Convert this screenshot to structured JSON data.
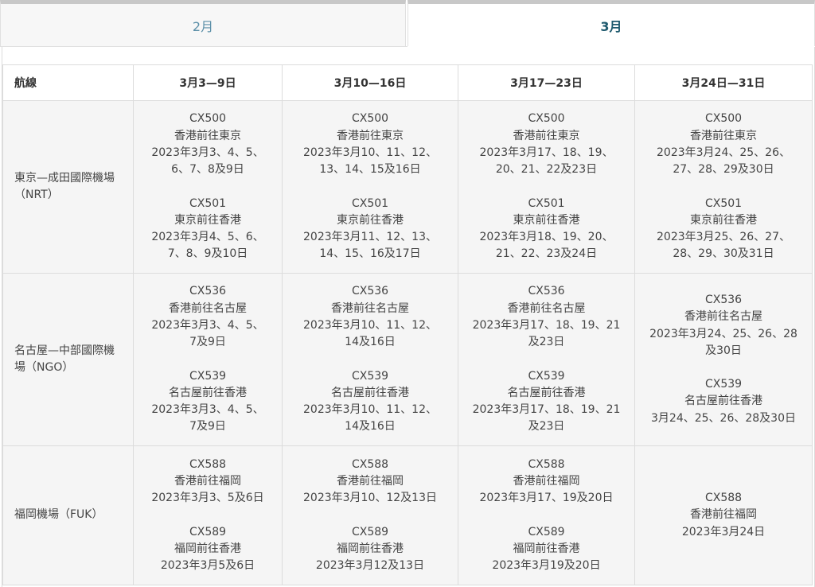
{
  "tabs": [
    {
      "label": "2月",
      "active": false
    },
    {
      "label": "3月",
      "active": true
    }
  ],
  "table": {
    "headers": [
      "航線",
      "3月3—9日",
      "3月10—16日",
      "3月17—23日",
      "3月24日—31日"
    ],
    "rows": [
      {
        "route": "東京—成田國際機場（NRT）",
        "cells": [
          [
            {
              "code": "CX500",
              "dir": "香港前往東京",
              "dates": [
                "2023年3月3、4、5、",
                "6、7、8及9日"
              ]
            },
            {
              "code": "CX501",
              "dir": "東京前往香港",
              "dates": [
                "2023年3月4、5、6、",
                "7、8、9及10日"
              ]
            }
          ],
          [
            {
              "code": "CX500",
              "dir": "香港前往東京",
              "dates": [
                "2023年3月10、11、12、",
                "13、14、15及16日"
              ]
            },
            {
              "code": "CX501",
              "dir": "東京前往香港",
              "dates": [
                "2023年3月11、12、13、",
                "14、15、16及17日"
              ]
            }
          ],
          [
            {
              "code": "CX500",
              "dir": "香港前往東京",
              "dates": [
                "2023年3月17、18、19、",
                "20、21、22及23日"
              ]
            },
            {
              "code": "CX501",
              "dir": "東京前往香港",
              "dates": [
                "2023年3月18、19、20、",
                "21、22、23及24日"
              ]
            }
          ],
          [
            {
              "code": "CX500",
              "dir": "香港前往東京",
              "dates": [
                "2023年3月24、25、26、",
                "27、28、29及30日"
              ]
            },
            {
              "code": "CX501",
              "dir": "東京前往香港",
              "dates": [
                "2023年3月25、26、27、",
                "28、29、30及31日"
              ]
            }
          ]
        ]
      },
      {
        "route": "名古屋—中部國際機場（NGO）",
        "cells": [
          [
            {
              "code": "CX536",
              "dir": "香港前往名古屋",
              "dates": [
                "2023年3月3、4、5、",
                "7及9日"
              ]
            },
            {
              "code": "CX539",
              "dir": "名古屋前往香港",
              "dates": [
                "2023年3月3、4、5、",
                "7及9日"
              ]
            }
          ],
          [
            {
              "code": "CX536",
              "dir": "香港前往名古屋",
              "dates": [
                "2023年3月10、11、12、",
                "14及16日"
              ]
            },
            {
              "code": "CX539",
              "dir": "名古屋前往香港",
              "dates": [
                "2023年3月10、11、12、",
                "14及16日"
              ]
            }
          ],
          [
            {
              "code": "CX536",
              "dir": "香港前往名古屋",
              "dates": [
                "2023年3月17、18、19、21",
                "及23日"
              ]
            },
            {
              "code": "CX539",
              "dir": "名古屋前往香港",
              "dates": [
                "2023年3月17、18、19、21",
                "及23日"
              ]
            }
          ],
          [
            {
              "code": "CX536",
              "dir": "香港前往名古屋",
              "dates": [
                "2023年3月24、25、26、28",
                "及30日"
              ]
            },
            {
              "code": "CX539",
              "dir": "名古屋前往香港",
              "dates": [
                "3月24、25、26、28及30日"
              ]
            }
          ]
        ]
      },
      {
        "route": "福岡機場（FUK）",
        "cells": [
          [
            {
              "code": "CX588",
              "dir": "香港前往福岡",
              "dates": [
                "2023年3月3、5及6日"
              ]
            },
            {
              "code": "CX589",
              "dir": "福岡前往香港",
              "dates": [
                "2023年3月5及6日"
              ]
            }
          ],
          [
            {
              "code": "CX588",
              "dir": "香港前往福岡",
              "dates": [
                "2023年3月10、12及13日"
              ]
            },
            {
              "code": "CX589",
              "dir": "福岡前往香港",
              "dates": [
                "2023年3月12及13日"
              ]
            }
          ],
          [
            {
              "code": "CX588",
              "dir": "香港前往福岡",
              "dates": [
                "2023年3月17、19及20日"
              ]
            },
            {
              "code": "CX589",
              "dir": "福岡前往香港",
              "dates": [
                "2023年3月19及20日"
              ]
            }
          ],
          [
            {
              "code": "CX588",
              "dir": "香港前往福岡",
              "dates": [
                "2023年3月24日"
              ]
            }
          ]
        ]
      }
    ]
  }
}
